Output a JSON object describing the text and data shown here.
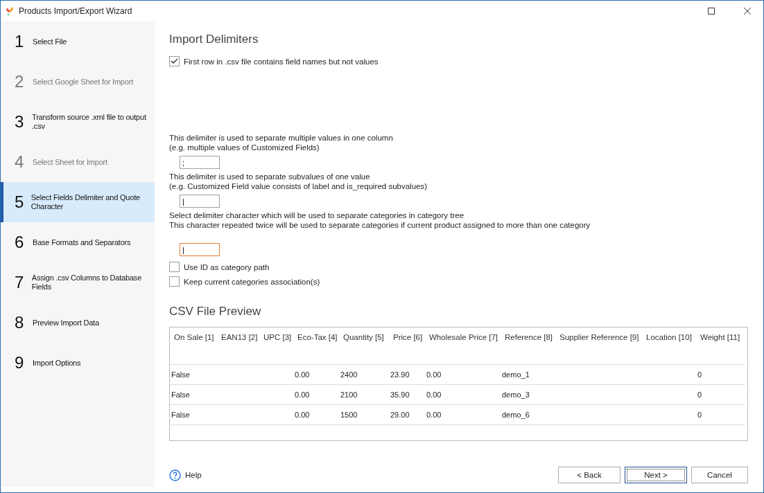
{
  "window": {
    "title": "Products Import/Export Wizard"
  },
  "steps": [
    {
      "number": "1",
      "label": "Select File",
      "selected": false,
      "disabled": false
    },
    {
      "number": "2",
      "label": "Select Google Sheet for Import",
      "selected": false,
      "disabled": true
    },
    {
      "number": "3",
      "label": "Transform source .xml file to output .csv",
      "selected": false,
      "disabled": false
    },
    {
      "number": "4",
      "label": "Select Sheet for Import",
      "selected": false,
      "disabled": true
    },
    {
      "number": "5",
      "label": "Select Fields Delimiter and Quote Character",
      "selected": true,
      "disabled": false
    },
    {
      "number": "6",
      "label": "Base Formats and Separators",
      "selected": false,
      "disabled": false
    },
    {
      "number": "7",
      "label": "Assign .csv Columns to Database Fields",
      "selected": false,
      "disabled": false
    },
    {
      "number": "8",
      "label": "Preview Import Data",
      "selected": false,
      "disabled": false
    },
    {
      "number": "9",
      "label": "Import Options",
      "selected": false,
      "disabled": false
    }
  ],
  "section_title": "Import Delimiters",
  "first_row_option": {
    "label": "First row in .csv file contains field names but not values",
    "checked": true
  },
  "delimiters": [
    {
      "lines": [
        "This delimiter is used to separate multiple values in one column",
        "(e.g. multiple values of Customized Fields)"
      ],
      "value": ";",
      "focused": false
    },
    {
      "lines": [
        "This delimiter is used to separate subvalues of one value",
        "(e.g. Customized Field value consists of label and is_required subvalues)"
      ],
      "value": "|",
      "focused": false
    },
    {
      "lines": [
        "Select delimiter character which will be used to separate categories in category tree",
        "This character repeated twice will be used to separate categories if current product assigned to more than one category"
      ],
      "value": "|",
      "focused": true
    }
  ],
  "options": [
    {
      "label": "Use ID as category path",
      "checked": false
    },
    {
      "label": "Keep current categories association(s)",
      "checked": false
    }
  ],
  "preview_title": "CSV File Preview",
  "table": {
    "columns": [
      "On Sale [1]",
      "EAN13 [2]",
      "UPC [3]",
      "Eco-Tax [4]",
      "Quantity [5]",
      "Price [6]",
      "Wholesale Price [7]",
      "Reference [8]",
      "Supplier Reference [9]",
      "Location [10]",
      "Weight [11]"
    ],
    "rows": [
      [
        "False",
        "",
        "",
        "0.00",
        "2400",
        "23.90",
        "0.00",
        "demo_1",
        "",
        "",
        "0"
      ],
      [
        "False",
        "",
        "",
        "0.00",
        "2100",
        "35.90",
        "0.00",
        "demo_3",
        "",
        "",
        "0"
      ],
      [
        "False",
        "",
        "",
        "0.00",
        "1500",
        "29.00",
        "0.00",
        "demo_6",
        "",
        "",
        "0"
      ]
    ]
  },
  "help": "Help",
  "buttons": [
    {
      "label": "< Back",
      "default": false
    },
    {
      "label": "Next >",
      "default": true
    },
    {
      "label": "Cancel",
      "default": false
    }
  ]
}
